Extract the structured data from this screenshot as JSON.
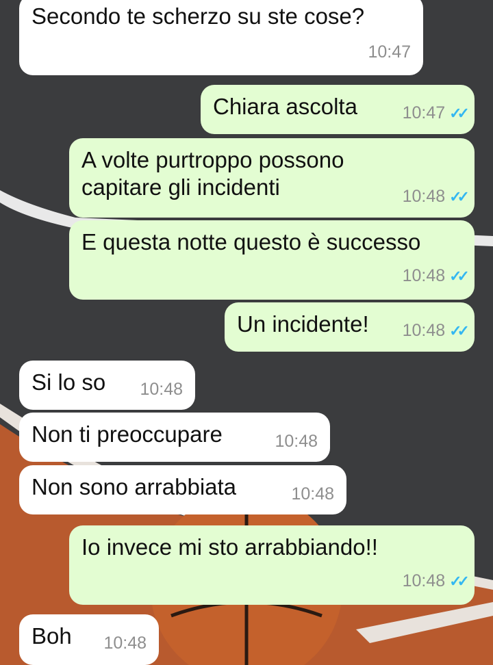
{
  "messages": [
    {
      "direction": "in",
      "text": "Secondo te scherzo su ste cose?",
      "time": "10:47"
    },
    {
      "direction": "out",
      "text": "Chiara ascolta",
      "time": "10:47",
      "read": true
    },
    {
      "direction": "out",
      "text": "A volte purtroppo possono\ncapitare gli incidenti",
      "time": "10:48",
      "read": true
    },
    {
      "direction": "out",
      "text": "E questa notte questo è successo",
      "time": "10:48",
      "read": true
    },
    {
      "direction": "out",
      "text": "Un incidente!",
      "time": "10:48",
      "read": true
    },
    {
      "direction": "in",
      "text": "Si lo so",
      "time": "10:48"
    },
    {
      "direction": "in",
      "text": "Non ti preoccupare",
      "time": "10:48"
    },
    {
      "direction": "in",
      "text": "Non sono arrabbiata",
      "time": "10:48"
    },
    {
      "direction": "out",
      "text": "Io invece mi sto arrabbiando!!",
      "time": "10:48",
      "read": true
    },
    {
      "direction": "in",
      "text": "Boh",
      "time": "10:48"
    }
  ],
  "icons": {
    "read_receipt": "double-check-icon"
  },
  "colors": {
    "incoming_bubble": "#ffffff",
    "outgoing_bubble": "#e3fdd2",
    "read_tick": "#34b7f1",
    "timestamp": "#8e8e8e"
  }
}
